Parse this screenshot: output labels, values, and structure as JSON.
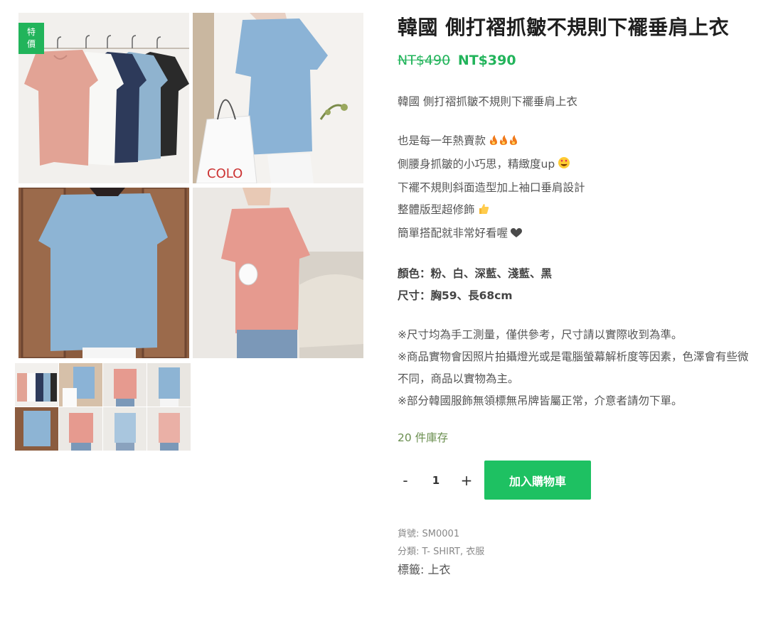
{
  "gallery": {
    "sale_badge": [
      "特",
      "價"
    ],
    "zoom_icon": "magnifier-icon",
    "thumb_count": 8
  },
  "product": {
    "title": "韓國 側打褶抓皺不規則下襬垂肩上衣",
    "price_old": "NT$490",
    "price_new": "NT$390",
    "desc_intro": "韓國 側打褶抓皺不規則下襬垂肩上衣",
    "highlights": [
      "也是每一年熱賣款",
      "側腰身抓皺的小巧思，精緻度up",
      "下襬不規則斜面造型加上袖口垂肩設計",
      "整體版型超修飾",
      "簡單搭配就非常好看喔"
    ],
    "color_line": "顏色：粉、白、深藍、淺藍、黑",
    "size_line": "尺寸：胸59、長68cm",
    "notes": [
      "※尺寸均為手工測量，僅供參考，尺寸請以實際收到為準。",
      "※商品實物會因照片拍攝燈光或是電腦螢幕解析度等因素，色澤會有些微不同，商品以實物為主。",
      "※部分韓國服飾無領標無吊牌皆屬正常，介意者請勿下單。"
    ],
    "stock": "20 件庫存"
  },
  "cart": {
    "minus": "-",
    "qty": "1",
    "plus": "+",
    "add_label": "加入購物車"
  },
  "meta": {
    "sku_label": "貨號:",
    "sku": "SM0001",
    "cat_label": "分類:",
    "categories": "T- SHIRT, 衣服",
    "tag_label": "標籤:",
    "tags": "上衣"
  },
  "colors": {
    "accent": "#22b45b",
    "button": "#1ec162",
    "stock": "#6b8f50"
  }
}
